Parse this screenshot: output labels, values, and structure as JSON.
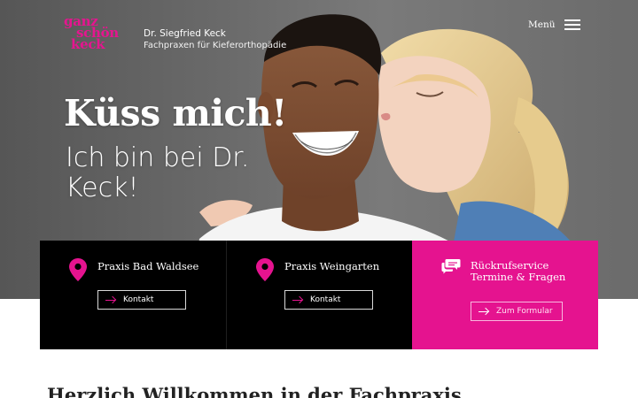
{
  "header": {
    "logo": [
      "ganz",
      "schön",
      "keck"
    ],
    "brand_name": "Dr. Siegfried Keck",
    "brand_sub": "Fachpraxen für Kieferorthopädie",
    "menu_label": "Menü"
  },
  "hero": {
    "headline": "Küss mich!",
    "subheadline": "Ich bin bei Dr. Keck!"
  },
  "cards": [
    {
      "title": "Praxis Bad Waldsee",
      "button": "Kontakt",
      "icon": "map-pin-icon"
    },
    {
      "title": "Praxis Weingarten",
      "button": "Kontakt",
      "icon": "map-pin-icon"
    },
    {
      "title_line1": "Rückrufservice",
      "title_line2": "Termine & Fragen",
      "button": "Zum Formular",
      "icon": "chat-bubbles-icon"
    }
  ],
  "welcome": "Herzlich Willkommen in der Fachpraxis",
  "colors": {
    "accent": "#e5138f",
    "dark": "#000000",
    "hero_bg": "#6a6a6a"
  }
}
